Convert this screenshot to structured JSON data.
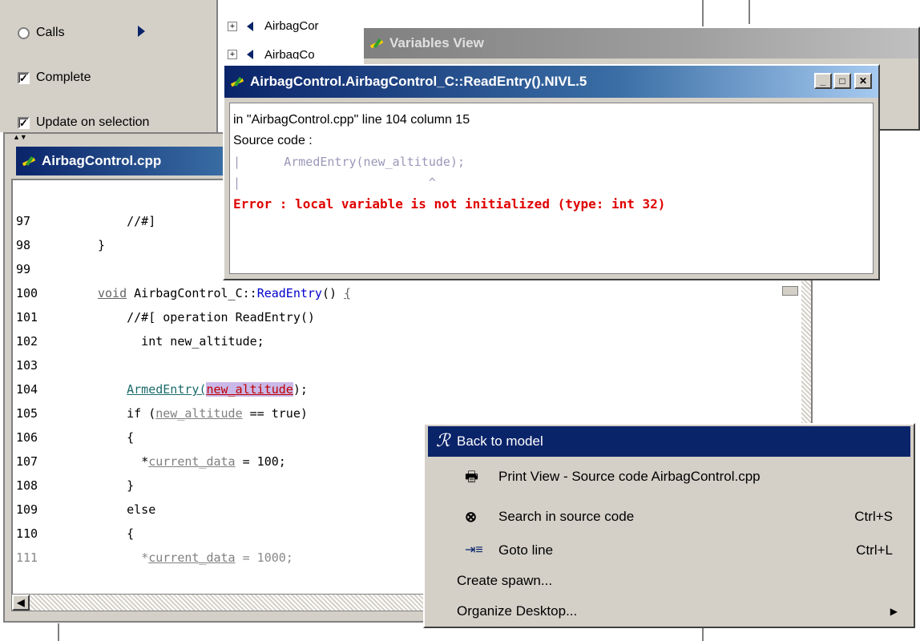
{
  "left_panel": {
    "calls_label": "Calls",
    "complete_label": "Complete",
    "update_label": "Update on selection",
    "complete_check": "✓",
    "update_check": "✓"
  },
  "tree": {
    "items": [
      "AirbagCor",
      "AirbagCo"
    ]
  },
  "variables_view": {
    "title": "Variables View"
  },
  "popup": {
    "title": "AirbagControl.AirbagControl_C::ReadEntry().NIVL.5",
    "location": "in \"AirbagControl.cpp\" line 104 column 15",
    "source_label": "Source code :",
    "code_line": "ArmedEntry(new_altitude);",
    "caret": "^",
    "error": "Error : local variable is not initialized (type: int 32)",
    "btn_min": "_",
    "btn_max": "□",
    "btn_close": "✕"
  },
  "editor": {
    "title": "AirbagControl.cpp",
    "lines": [
      {
        "num": "97",
        "text": "    //#]"
      },
      {
        "num": "98",
        "text": "}"
      },
      {
        "num": "99",
        "text": ""
      },
      {
        "num": "100",
        "text": ""
      },
      {
        "num": "101",
        "text": "    //#[ operation ReadEntry()"
      },
      {
        "num": "102",
        "text": "      int new_altitude;"
      },
      {
        "num": "103",
        "text": ""
      },
      {
        "num": "104",
        "text": ""
      },
      {
        "num": "105",
        "text": ""
      },
      {
        "num": "106",
        "text": "    {"
      },
      {
        "num": "107",
        "text": ""
      },
      {
        "num": "108",
        "text": "    }"
      },
      {
        "num": "109",
        "text": "    else"
      },
      {
        "num": "110",
        "text": "    {"
      },
      {
        "num": "111",
        "text": ""
      }
    ],
    "line100": {
      "kw": "void",
      "cls": " AirbagControl_C::",
      "fn": "ReadEntry",
      "rest": "() ",
      "brace": "{"
    },
    "line104": {
      "fn": "ArmedEntry",
      "open": "(",
      "var": "new_altitude",
      "close": ");"
    },
    "line105": {
      "pre": "if (",
      "var": "new_altitude",
      "rest": " == true)"
    },
    "line107": {
      "star": "*",
      "var": "current_data",
      "rest": " = 100;"
    },
    "line111": {
      "star": "*",
      "var": "current_data",
      "rest": " = 1000;"
    }
  },
  "context_menu": {
    "items": [
      {
        "label": "Back to model",
        "shortcut": "",
        "icon": "rhapsody-icon"
      },
      {
        "label": "Print View - Source code AirbagControl.cpp",
        "shortcut": "",
        "icon": "printer-icon"
      },
      {
        "label": "Search in source code",
        "shortcut": "Ctrl+S",
        "icon": "binoculars-icon"
      },
      {
        "label": "Goto line",
        "shortcut": "Ctrl+L",
        "icon": "goto-line-icon"
      },
      {
        "label": "Create spawn...",
        "shortcut": "",
        "icon": ""
      },
      {
        "label": "Organize Desktop...",
        "shortcut": "",
        "icon": ""
      }
    ],
    "submenu_arrow": "▶"
  },
  "colors": {
    "selection": "#0a246a",
    "error_red": "#e00000",
    "window_grey": "#d4d0c8"
  }
}
